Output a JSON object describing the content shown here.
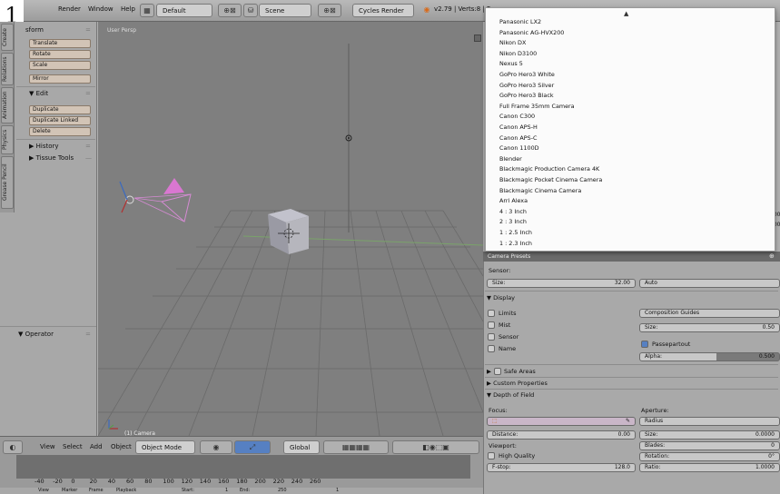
{
  "topbar": {
    "menu_render": "Render",
    "menu_window": "Window",
    "menu_help": "Help",
    "layout": "Default",
    "scene": "Scene",
    "engine": "Cycles Render",
    "version": "v2.79 | Verts:8 | F"
  },
  "corner_number": "1",
  "toolshelf": {
    "tabs": [
      "Create",
      "Relations",
      "Animation",
      "Physics",
      "Grease Pencil"
    ],
    "transform_header": "sform",
    "transform_buttons": [
      "Translate",
      "Rotate",
      "Scale"
    ],
    "mirror": "Mirror",
    "edit_header": "▼ Edit",
    "edit_buttons": [
      "Duplicate",
      "Duplicate Linked",
      "Delete"
    ],
    "history": "▶ History",
    "tissue": "▶ Tissue Tools",
    "operator": "▼ Operator"
  },
  "viewport": {
    "label": "User Persp",
    "camera_label": "(1) Camera"
  },
  "preset_dropdown": {
    "items": [
      "Panasonic LX2",
      "Panasonic AG-HVX200",
      "Nikon DX",
      "Nikon D3100",
      "Nexus 5",
      "GoPro Hero3 White",
      "GoPro Hero3 Silver",
      "GoPro Hero3 Black",
      "Full Frame 35mm Camera",
      "Canon C300",
      "Canon APS-H",
      "Canon APS-C",
      "Canon 1100D",
      "Blender",
      "Blackmagic Production Camera 4K",
      "Blackmagic Pocket Cinema Camera",
      "Blackmagic Cinema Camera",
      "Arri Alexa",
      "4 : 3 Inch",
      "2 : 3 Inch",
      "1 : 2.5 Inch",
      "1 : 2.3 Inch"
    ]
  },
  "properties": {
    "presets_header": "Camera Presets",
    "sensor_label": "Sensor:",
    "size_label": "Size:",
    "size_value": "32.00",
    "sensor_fit": "Auto",
    "display_header": "▼ Display",
    "limits": "Limits",
    "mist": "Mist",
    "sensor": "Sensor",
    "name": "Name",
    "composition_guides": "Composition Guides",
    "guide_size_label": "Size:",
    "guide_size_value": "0.50",
    "passepartout": "Passepartout",
    "alpha_label": "Alpha:",
    "alpha_value": "0.500",
    "safe_areas": "Safe Areas",
    "custom_properties": "▶ Custom Properties",
    "dof_header": "▼ Depth of Field",
    "focus_label": "Focus:",
    "distance_label": "Distance:",
    "distance_value": "0.00",
    "viewport_label": "Viewport:",
    "high_quality": "High Quality",
    "fstop_label": "F-stop:",
    "fstop_value": "128.0",
    "aperture_label": "Aperture:",
    "aperture_type": "Radius",
    "ap_size_label": "Size:",
    "ap_size_value": "0.0000",
    "blades_label": "Blades:",
    "blades_value": "0",
    "rotation_label": "Rotation:",
    "rotation_value": "0°",
    "ratio_label": "Ratio:",
    "ratio_value": "1.0000",
    "right_values": [
      "100",
      "000"
    ]
  },
  "timeline": {
    "view": "View",
    "select": "Select",
    "add": "Add",
    "object": "Object",
    "mode": "Object Mode",
    "orientation": "Global",
    "numbers": [
      "-40",
      "-20",
      "0",
      "20",
      "40",
      "60",
      "80",
      "100",
      "120",
      "140",
      "160",
      "180",
      "200",
      "220",
      "240",
      "260"
    ],
    "bottom": [
      "View",
      "Marker",
      "Frame",
      "Playback",
      "Start:",
      "1",
      "End:",
      "250",
      "1"
    ]
  },
  "colors": {
    "accent": "#5680c2",
    "dropdown_bg": "#fbfbfb",
    "viewport_bg": "#7f7f7f"
  }
}
